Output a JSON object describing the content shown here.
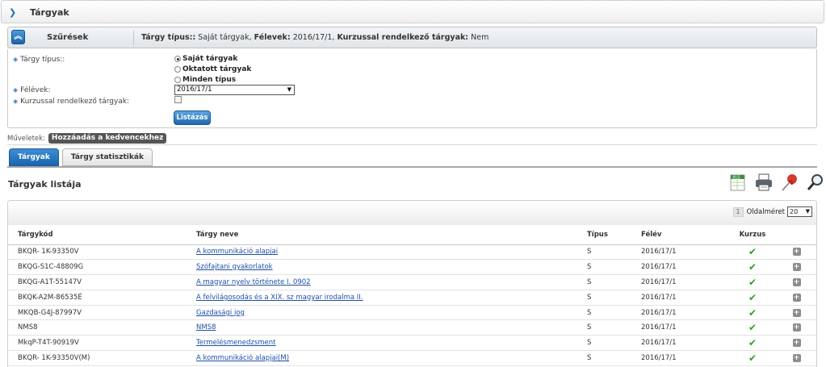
{
  "window": {
    "title": "Tárgyak"
  },
  "filter": {
    "toggle_icon": "chevron-up-icon",
    "label": "Szűrések",
    "summary": [
      {
        "key": "Tárgy típus::",
        "value": "Saját tárgyak,"
      },
      {
        "key": "Félevek:",
        "value": "2016/17/1,"
      },
      {
        "key": "Kurzussal rendelkező tárgyak:",
        "value": "Nem"
      }
    ],
    "type_label": "Tárgy típus::",
    "type_options": [
      "Saját tárgyak",
      "Oktatott tárgyak",
      "Minden típus"
    ],
    "type_selected": "Saját tárgyak",
    "semester_label": "Félévek:",
    "semester_value": "2016/17/1",
    "course_label": "Kurzussal rendelkező tárgyak:",
    "course_checked": false,
    "list_button": "Listázás"
  },
  "operations": {
    "label": "Műveletek:",
    "favorite_button": "Hozzáadás a kedvencekhez"
  },
  "tabs": [
    {
      "label": "Tárgyak",
      "active": true
    },
    {
      "label": "Tárgy statisztikák",
      "active": false
    }
  ],
  "list": {
    "title": "Tárgyak listája",
    "toolbar_icons": [
      "excel-export-icon",
      "print-icon",
      "pin-icon",
      "search-icon"
    ],
    "pager": {
      "page": "1",
      "page_size_label": "Oldalméret",
      "page_size": "20"
    },
    "columns": [
      "Tárgykód",
      "Tárgy neve",
      "Típus",
      "Félév",
      "Kurzus"
    ],
    "rows": [
      {
        "code": "BKQR- 1K-93350V",
        "name": "A kommunikáció alapjai",
        "type": "S",
        "semester": "2016/17/1",
        "course": true
      },
      {
        "code": "BKQG-S1C-48809G",
        "name": "Szófajtani gyakorlatok",
        "type": "S",
        "semester": "2016/17/1",
        "course": true
      },
      {
        "code": "BKQG-A1T-55147V",
        "name": "A magyar nyelv története I. 0902",
        "type": "S",
        "semester": "2016/17/1",
        "course": true
      },
      {
        "code": "BKQK-A2M-86535É",
        "name": "A felvilágosodás és a XIX. sz magyar irodalma II.",
        "type": "S",
        "semester": "2016/17/1",
        "course": true
      },
      {
        "code": "MKQB-G4J-87997V",
        "name": "Gazdasági jog",
        "type": "S",
        "semester": "2016/17/1",
        "course": true
      },
      {
        "code": "NMS8",
        "name": "NMS8",
        "type": "S",
        "semester": "2016/17/1",
        "course": true
      },
      {
        "code": "MkqP-T4T-90919V",
        "name": "Termelésmenedzsment",
        "type": "S",
        "semester": "2016/17/1",
        "course": true
      },
      {
        "code": "BKQR- 1K-93350V(M)",
        "name": "A kommunikáció alapjai(M)",
        "type": "S",
        "semester": "2016/17/1",
        "course": true
      }
    ]
  }
}
